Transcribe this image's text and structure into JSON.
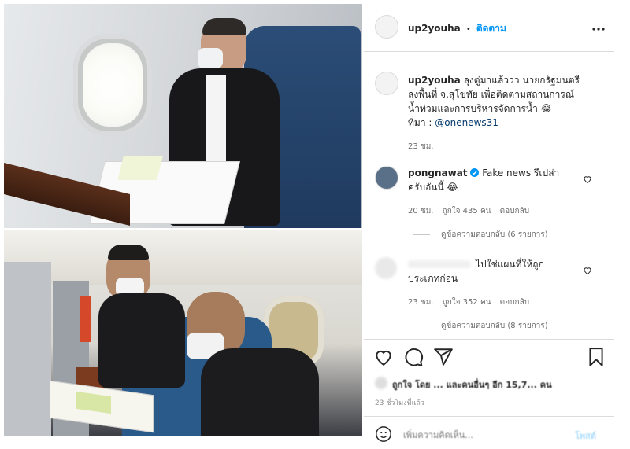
{
  "header": {
    "username": "up2youha",
    "separator": "•",
    "follow_label": "ติดตาม",
    "more_icon": "more-dots-icon"
  },
  "caption": {
    "username": "up2youha",
    "text_1": "ลุงตู่มาแล้ววว นายกรัฐมนตรี",
    "text_2": "ลงพื้นที่ จ.สุโขทัย เพื่อติดตามสถานการณ์",
    "text_3": "น้ำท่วมและการบริหารจัดการน้ำ 😂",
    "source_label": "ที่มา :",
    "source_handle": "@onenews31",
    "time": "23 ชม."
  },
  "comments": [
    {
      "username": "pongnawat",
      "verified_icon": "verified-badge-icon",
      "text_1": "Fake news รึเปล่า",
      "text_2": "ครับอันนี้ 😂",
      "time": "20 ชม.",
      "likes": "ถูกใจ 435 คน",
      "reply_label": "ตอบกลับ",
      "view_replies": "ดูข้อความตอบกลับ (6 รายการ)"
    },
    {
      "text_1": "ไปใช่แผนที่ให้ถูก",
      "text_2": "ประเภทก่อน",
      "time": "23 ชม.",
      "likes": "ถูกใจ 352 คน",
      "reply_label": "ตอบกลับ",
      "view_replies": "ดูข้อความตอบกลับ (8 รายการ)"
    }
  ],
  "actions": {
    "like_icon": "heart-icon",
    "comment_icon": "comment-icon",
    "share_icon": "send-icon",
    "save_icon": "bookmark-icon"
  },
  "likes_summary": "ถูกใจ โดย ... และคนอื่นๆ อีก 15,7... คน",
  "post_time": "23 ชั่วโมงที่แล้ว",
  "add_comment": {
    "placeholder": "เพิ่มความคิดเห็น...",
    "post_label": "โพสต์"
  },
  "colors": {
    "link_blue": "#0095f6",
    "text": "#262626",
    "muted": "#8e8e8e",
    "border": "#dbdbdb"
  }
}
